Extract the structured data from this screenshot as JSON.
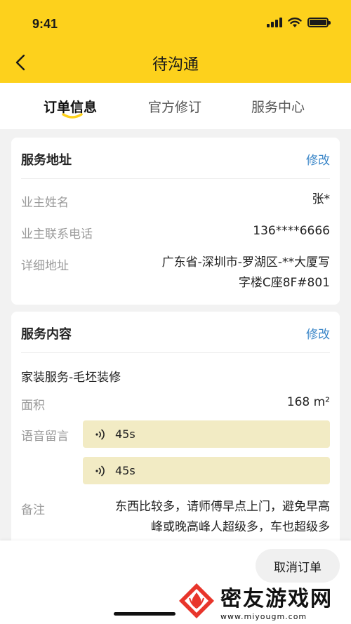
{
  "status_bar": {
    "time": "9:41"
  },
  "nav": {
    "title": "待沟通"
  },
  "tabs": [
    {
      "label": "订单信息",
      "active": true
    },
    {
      "label": "官方修订",
      "active": false
    },
    {
      "label": "服务中心",
      "active": false
    }
  ],
  "address_card": {
    "title": "服务地址",
    "edit_label": "修改",
    "rows": [
      {
        "label": "业主姓名",
        "value": "张*"
      },
      {
        "label": "业主联系电话",
        "value": "136****6666"
      },
      {
        "label": "详细地址",
        "value_line1": "广东省-深圳市-罗湖区-**大厦写",
        "value_line2": "字楼C座8F#801"
      }
    ]
  },
  "service_card": {
    "title": "服务内容",
    "edit_label": "修改",
    "service_type": "家装服务-毛坯装修",
    "area_label": "面积",
    "area_value": "168 m²",
    "voice_label": "语音留言",
    "voice_messages": [
      "45s",
      "45s"
    ],
    "remark_label": "备注",
    "remark_line1": "东西比较多，请师傅早点上门，避免早高",
    "remark_line2": "峰或晚高峰人超级多，车也超级多"
  },
  "footer": {
    "cancel_label": "取消订单"
  },
  "watermark": {
    "text": "密友游戏网",
    "url": "www.miyougm.com"
  },
  "colors": {
    "brand_yellow": "#fdd11c",
    "link_blue": "#3a86c8",
    "voice_bg": "#f2ebc4"
  }
}
